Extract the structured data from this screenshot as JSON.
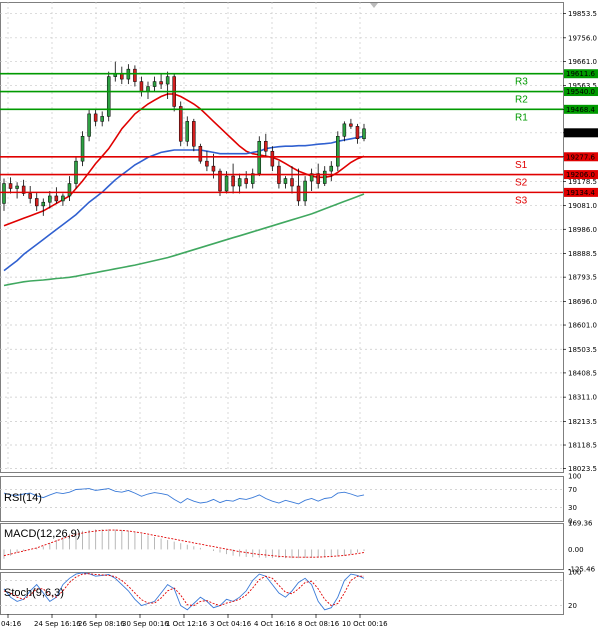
{
  "chart_data": [
    {
      "type": "candlestick",
      "title": "",
      "y_ticks": [
        "19853.5",
        "19756.0",
        "19661.0",
        "19563.5",
        "19468.4",
        "19374.0",
        "19277.6",
        "19178.5",
        "19081.0",
        "18986.0",
        "18888.5",
        "18793.5",
        "18696.0",
        "18601.0",
        "18503.5",
        "18408.5",
        "18311.0",
        "18213.5",
        "18118.5",
        "18023.5"
      ],
      "ylim": [
        18010,
        19900
      ],
      "x_ticks": [
        "04:16",
        "24 Sep 16:16",
        "26 Sep 08:16",
        "30 Sep 00:16",
        "1 Oct 12:16",
        "3 Oct 04:16",
        "4 Oct 16:16",
        "8 Oct 08:16",
        "10 Oct 00:16"
      ],
      "levels": [
        {
          "name": "R3",
          "value": 19611.6,
          "label": "19611.6",
          "color": "#009a00"
        },
        {
          "name": "R2",
          "value": 19540.0,
          "label": "19540.0",
          "color": "#009a00"
        },
        {
          "name": "R1",
          "value": 19468.4,
          "label": "19468.4",
          "color": "#009a00"
        },
        {
          "name": "S1",
          "value": 19277.6,
          "label": "19277.6",
          "color": "#e00000"
        },
        {
          "name": "S2",
          "value": 19206.0,
          "label": "19206.0",
          "color": "#e00000"
        },
        {
          "name": "S3",
          "value": 19134.4,
          "label": "19134.4",
          "color": "#e00000"
        }
      ],
      "last_price": {
        "value": 19374.0,
        "label": "19374.0"
      },
      "candles": [
        [
          19090,
          19190,
          19060,
          19170
        ],
        [
          19170,
          19195,
          19130,
          19150
        ],
        [
          19150,
          19175,
          19110,
          19160
        ],
        [
          19160,
          19185,
          19120,
          19130
        ],
        [
          19130,
          19160,
          19090,
          19110
        ],
        [
          19110,
          19135,
          19060,
          19080
        ],
        [
          19080,
          19110,
          19040,
          19095
        ],
        [
          19095,
          19140,
          19070,
          19120
        ],
        [
          19120,
          19155,
          19090,
          19100
        ],
        [
          19100,
          19130,
          19080,
          19120
        ],
        [
          19120,
          19200,
          19100,
          19170
        ],
        [
          19170,
          19280,
          19150,
          19260
        ],
        [
          19260,
          19380,
          19240,
          19360
        ],
        [
          19360,
          19470,
          19340,
          19450
        ],
        [
          19450,
          19470,
          19400,
          19420
        ],
        [
          19420,
          19460,
          19400,
          19440
        ],
        [
          19440,
          19620,
          19420,
          19600
        ],
        [
          19600,
          19660,
          19580,
          19610
        ],
        [
          19610,
          19640,
          19570,
          19590
        ],
        [
          19590,
          19650,
          19570,
          19630
        ],
        [
          19630,
          19645,
          19560,
          19580
        ],
        [
          19580,
          19600,
          19520,
          19540
        ],
        [
          19540,
          19580,
          19510,
          19560
        ],
        [
          19560,
          19600,
          19540,
          19580
        ],
        [
          19580,
          19610,
          19550,
          19570
        ],
        [
          19570,
          19620,
          19510,
          19600
        ],
        [
          19600,
          19610,
          19460,
          19480
        ],
        [
          19480,
          19500,
          19320,
          19340
        ],
        [
          19340,
          19440,
          19320,
          19420
        ],
        [
          19420,
          19430,
          19300,
          19320
        ],
        [
          19320,
          19330,
          19250,
          19260
        ],
        [
          19260,
          19300,
          19220,
          19240
        ],
        [
          19240,
          19290,
          19190,
          19220
        ],
        [
          19220,
          19230,
          19120,
          19140
        ],
        [
          19140,
          19220,
          19130,
          19200
        ],
        [
          19200,
          19250,
          19130,
          19160
        ],
        [
          19160,
          19210,
          19130,
          19190
        ],
        [
          19190,
          19220,
          19150,
          19170
        ],
        [
          19170,
          19230,
          19150,
          19210
        ],
        [
          19210,
          19360,
          19200,
          19340
        ],
        [
          19340,
          19370,
          19280,
          19300
        ],
        [
          19300,
          19320,
          19220,
          19240
        ],
        [
          19240,
          19260,
          19150,
          19170
        ],
        [
          19170,
          19200,
          19150,
          19190
        ],
        [
          19190,
          19240,
          19130,
          19160
        ],
        [
          19160,
          19230,
          19080,
          19100
        ],
        [
          19100,
          19200,
          19080,
          19180
        ],
        [
          19180,
          19230,
          19140,
          19210
        ],
        [
          19210,
          19250,
          19150,
          19170
        ],
        [
          19170,
          19240,
          19160,
          19220
        ],
        [
          19220,
          19260,
          19180,
          19240
        ],
        [
          19240,
          19380,
          19220,
          19360
        ],
        [
          19360,
          19420,
          19340,
          19410
        ],
        [
          19410,
          19430,
          19390,
          19400
        ],
        [
          19400,
          19410,
          19330,
          19350
        ],
        [
          19350,
          19410,
          19340,
          19390
        ]
      ],
      "moving_averages": [
        {
          "color": "#e00000",
          "values": [
            19000,
            19010,
            19020,
            19030,
            19040,
            19050,
            19060,
            19075,
            19090,
            19105,
            19120,
            19150,
            19180,
            19215,
            19250,
            19280,
            19310,
            19350,
            19390,
            19420,
            19450,
            19470,
            19490,
            19505,
            19520,
            19530,
            19530,
            19520,
            19505,
            19490,
            19470,
            19445,
            19420,
            19395,
            19370,
            19345,
            19320,
            19300,
            19290,
            19285,
            19280,
            19275,
            19265,
            19250,
            19235,
            19220,
            19210,
            19200,
            19195,
            19195,
            19200,
            19215,
            19235,
            19255,
            19270,
            19280
          ]
        },
        {
          "color": "#3060d0",
          "values": [
            18820,
            18840,
            18860,
            18885,
            18905,
            18925,
            18945,
            18965,
            18985,
            19005,
            19025,
            19045,
            19070,
            19095,
            19115,
            19135,
            19160,
            19185,
            19205,
            19225,
            19245,
            19260,
            19275,
            19285,
            19295,
            19300,
            19305,
            19305,
            19305,
            19305,
            19305,
            19300,
            19295,
            19290,
            19290,
            19290,
            19290,
            19290,
            19295,
            19300,
            19310,
            19315,
            19318,
            19320,
            19320,
            19322,
            19322,
            19325,
            19328,
            19330,
            19333,
            19340,
            19345,
            19350,
            19355,
            19360
          ]
        },
        {
          "color": "#40a860",
          "values": [
            18760,
            18765,
            18770,
            18775,
            18778,
            18780,
            18782,
            18785,
            18788,
            18790,
            18793,
            18797,
            18802,
            18807,
            18812,
            18817,
            18822,
            18827,
            18832,
            18837,
            18842,
            18848,
            18854,
            18860,
            18866,
            18872,
            18880,
            18888,
            18896,
            18904,
            18912,
            18920,
            18928,
            18936,
            18944,
            18952,
            18960,
            18968,
            18976,
            18984,
            18992,
            19000,
            19008,
            19016,
            19024,
            19032,
            19040,
            19048,
            19058,
            19068,
            19078,
            19088,
            19098,
            19108,
            19118,
            19128
          ]
        }
      ]
    },
    {
      "type": "line",
      "title": "RSI(14)",
      "y_ticks": [
        "100",
        "70",
        "30",
        "0"
      ],
      "ylim": [
        0,
        100
      ],
      "series": [
        {
          "color": "#3a7ad8",
          "values": [
            62,
            58,
            57,
            60,
            62,
            56,
            52,
            58,
            63,
            61,
            64,
            70,
            71,
            72,
            68,
            70,
            72,
            66,
            64,
            68,
            62,
            55,
            60,
            63,
            61,
            58,
            48,
            40,
            50,
            44,
            40,
            42,
            48,
            41,
            46,
            44,
            50,
            48,
            52,
            58,
            50,
            44,
            40,
            46,
            42,
            38,
            46,
            50,
            44,
            50,
            52,
            62,
            64,
            60,
            55,
            58
          ]
        }
      ]
    },
    {
      "type": "bar",
      "title": "MACD(12,26,9)",
      "y_ticks": [
        "169.36",
        "0.00",
        "-125.46"
      ],
      "ylim": [
        -125.46,
        169.36
      ],
      "histogram": [
        -60,
        -40,
        -20,
        -10,
        0,
        10,
        20,
        40,
        60,
        80,
        100,
        110,
        120,
        125,
        128,
        130,
        130,
        128,
        124,
        118,
        110,
        100,
        90,
        80,
        70,
        60,
        50,
        40,
        30,
        20,
        10,
        0,
        -10,
        -20,
        -30,
        -40,
        -45,
        -48,
        -50,
        -52,
        -54,
        -55,
        -55,
        -56,
        -56,
        -56,
        -55,
        -54,
        -53,
        -52,
        -50,
        -45,
        -40,
        -30,
        -20,
        -10
      ],
      "series": [
        {
          "color": "#e00000",
          "values": [
            -40,
            -30,
            -20,
            -10,
            0,
            10,
            25,
            40,
            55,
            70,
            85,
            95,
            105,
            112,
            118,
            122,
            124,
            124,
            122,
            118,
            112,
            106,
            98,
            90,
            82,
            74,
            66,
            58,
            50,
            42,
            34,
            26,
            18,
            10,
            2,
            -6,
            -14,
            -20,
            -26,
            -32,
            -36,
            -40,
            -44,
            -47,
            -49,
            -50,
            -50,
            -50,
            -49,
            -47,
            -45,
            -42,
            -38,
            -33,
            -27,
            -20
          ]
        }
      ]
    },
    {
      "type": "line",
      "title": "Stoch(9,6,3)",
      "y_ticks": [
        "100",
        "20"
      ],
      "ylim": [
        0,
        100
      ],
      "series": [
        {
          "color": "#3a7ad8",
          "values": [
            60,
            40,
            30,
            35,
            55,
            70,
            50,
            30,
            40,
            70,
            85,
            95,
            98,
            96,
            90,
            92,
            94,
            85,
            70,
            55,
            35,
            20,
            25,
            30,
            50,
            70,
            60,
            20,
            10,
            25,
            40,
            30,
            15,
            20,
            35,
            30,
            40,
            55,
            80,
            95,
            90,
            70,
            50,
            40,
            55,
            75,
            85,
            70,
            30,
            10,
            15,
            40,
            80,
            95,
            92,
            85
          ]
        },
        {
          "color": "#e00000",
          "values": [
            55,
            50,
            40,
            35,
            45,
            60,
            60,
            45,
            40,
            55,
            75,
            88,
            95,
            96,
            94,
            93,
            92,
            89,
            80,
            66,
            50,
            34,
            26,
            26,
            38,
            55,
            62,
            45,
            22,
            20,
            30,
            32,
            25,
            20,
            26,
            30,
            35,
            45,
            62,
            82,
            90,
            85,
            68,
            52,
            48,
            60,
            75,
            78,
            60,
            35,
            20,
            25,
            50,
            80,
            90,
            90
          ]
        }
      ]
    }
  ]
}
